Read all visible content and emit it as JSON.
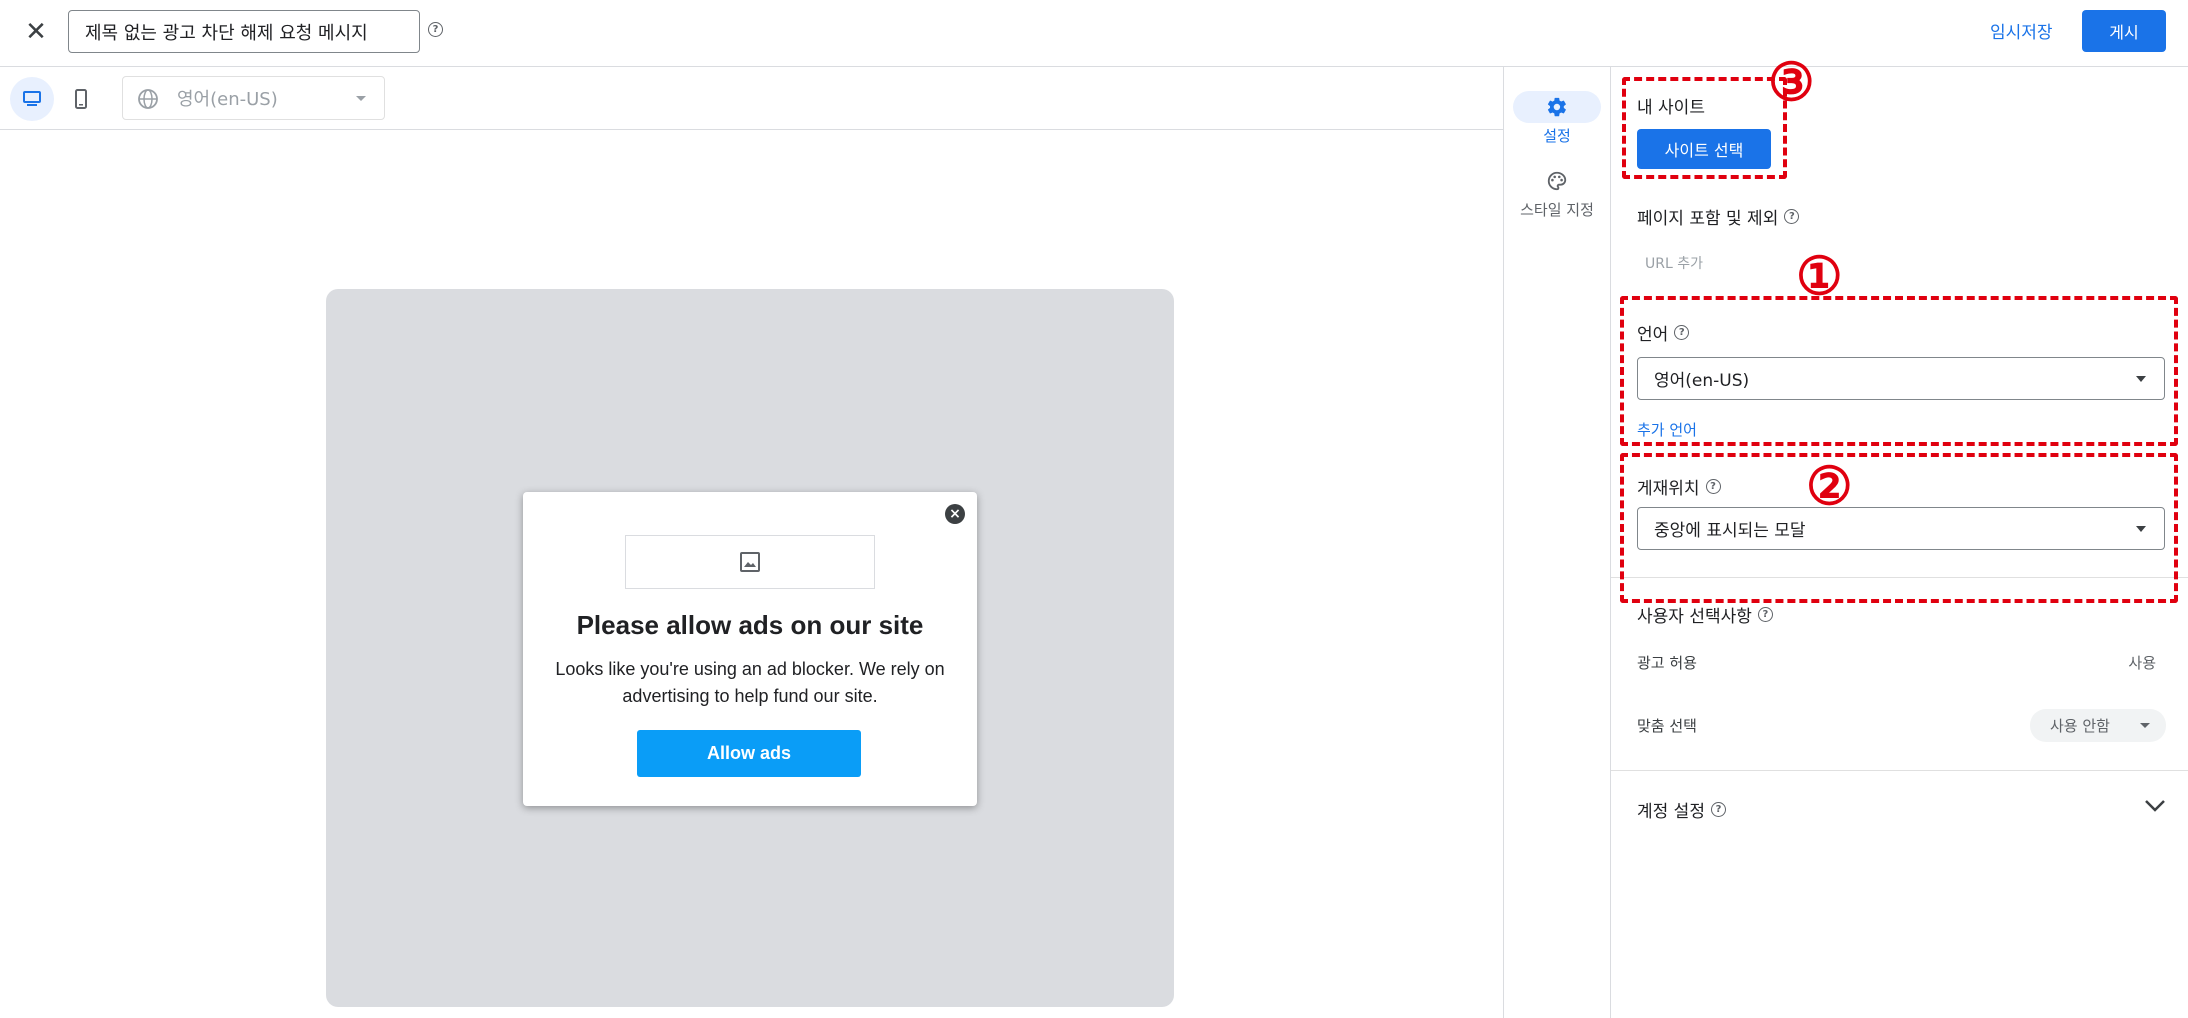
{
  "header": {
    "close_label": "✕",
    "title_value": "제목 없는 광고 차단 해제 요청 메시지",
    "help": "?",
    "draft_label": "임시저장",
    "publish_label": "게시"
  },
  "toolbar": {
    "language_value": "영어(en-US)"
  },
  "preview": {
    "modal_title": "Please allow ads on our site",
    "modal_body": "Looks like you're using an ad blocker. We rely on advertising to help fund our site.",
    "allow_button": "Allow ads",
    "close_glyph": "×"
  },
  "rail": {
    "items": [
      {
        "label": "설정",
        "icon": "gear-icon",
        "active": true
      },
      {
        "label": "스타일 지정",
        "icon": "palette-icon",
        "active": false
      }
    ]
  },
  "settings": {
    "my_site_label": "내 사이트",
    "select_site_button": "사이트 선택",
    "page_include_label": "페이지 포함 및 제외",
    "url_add": "URL 추가",
    "language_label": "언어",
    "language_value": "영어(en-US)",
    "add_language": "추가 언어",
    "placement_label": "게재위치",
    "placement_value": "중앙에 표시되는 모달",
    "user_choices_label": "사용자 선택사항",
    "allow_ads_label": "광고 허용",
    "allow_ads_value": "사용",
    "custom_choice_label": "맞춤 선택",
    "custom_choice_value": "사용 안함",
    "account_settings_label": "계정 설정"
  },
  "annotations": {
    "numbers": [
      "③",
      "①",
      "②"
    ],
    "color": "#e0000f"
  },
  "colors": {
    "accent": "#1a73e8",
    "allow_button": "#0a9df7",
    "preview_bg": "#dadce0"
  }
}
